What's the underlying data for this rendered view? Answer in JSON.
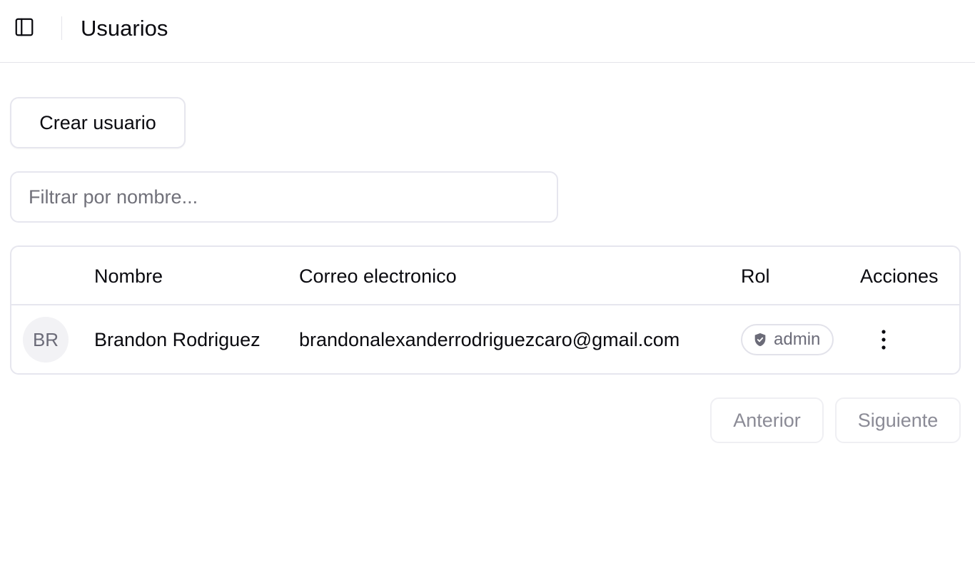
{
  "header": {
    "title": "Usuarios",
    "toggle_icon": "sidebar-panel-icon"
  },
  "toolbar": {
    "create_label": "Crear usuario"
  },
  "filter": {
    "placeholder": "Filtrar por nombre...",
    "value": ""
  },
  "table": {
    "columns": [
      "Nombre",
      "Correo electronico",
      "Rol",
      "Acciones"
    ],
    "rows": [
      {
        "initials": "BR",
        "name": "Brandon Rodriguez",
        "email": "brandonalexanderrodriguezcaro@gmail.com",
        "role": "admin",
        "role_icon": "shield-check-icon",
        "actions_icon": "more-vertical-icon"
      }
    ]
  },
  "pagination": {
    "prev_label": "Anterior",
    "next_label": "Siguiente"
  },
  "colors": {
    "border": "#e6e6ee",
    "text": "#0a0a0f",
    "muted": "#71717a",
    "badge_icon": "#6b6b78"
  }
}
